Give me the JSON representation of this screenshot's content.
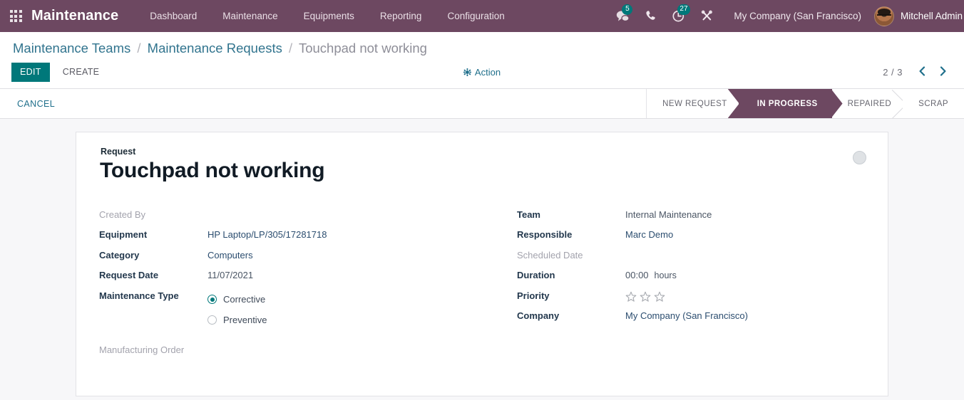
{
  "navbar": {
    "apps_icon": "apps-grid-icon",
    "brand": "Maintenance",
    "menu": [
      {
        "label": "Dashboard"
      },
      {
        "label": "Maintenance"
      },
      {
        "label": "Equipments"
      },
      {
        "label": "Reporting"
      },
      {
        "label": "Configuration"
      }
    ],
    "messaging": {
      "icon": "chat-bubble-icon",
      "badge": "5"
    },
    "voip": {
      "icon": "phone-icon"
    },
    "activities": {
      "icon": "clock-activity-icon",
      "badge": "27"
    },
    "debug": {
      "icon": "tools-wrench-icon"
    },
    "company": "My Company (San Francisco)",
    "user": "Mitchell Admin",
    "avatar_icon": "user-avatar",
    "bg_color": "#6d4861"
  },
  "breadcrumb": {
    "items": [
      {
        "label": "Maintenance Teams",
        "current": false
      },
      {
        "label": "Maintenance Requests",
        "current": false
      },
      {
        "label": "Touchpad not working",
        "current": true
      }
    ],
    "separator": "/"
  },
  "control_panel": {
    "edit_label": "EDIT",
    "create_label": "CREATE",
    "action_label": "Action",
    "action_icon": "gear-icon",
    "pager": {
      "counter": "2 / 3",
      "prev_icon": "chevron-left-icon",
      "next_icon": "chevron-right-icon"
    },
    "edit_color": "#00787a",
    "link_color": "#1f6f8b"
  },
  "statusbar": {
    "buttons": [
      {
        "label": "CANCEL"
      }
    ],
    "stages": [
      {
        "label": "NEW REQUEST",
        "active": false
      },
      {
        "label": "IN PROGRESS",
        "active": true
      },
      {
        "label": "REPAIRED",
        "active": false
      },
      {
        "label": "SCRAP",
        "active": false
      }
    ],
    "active_color": "#6d4861"
  },
  "form": {
    "title_label": "Request",
    "title_value": "Touchpad not working",
    "kanban_state_icon": "kanban-state-circle",
    "left_fields": [
      {
        "label": "Created By",
        "value": "",
        "type": "empty"
      },
      {
        "label": "Equipment",
        "value": "HP Laptop/LP/305/17281718",
        "type": "link"
      },
      {
        "label": "Category",
        "value": "Computers",
        "type": "link"
      },
      {
        "label": "Request Date",
        "value": "11/07/2021",
        "type": "text"
      }
    ],
    "maintenance_type": {
      "label": "Maintenance Type",
      "options": [
        {
          "label": "Corrective",
          "selected": true
        },
        {
          "label": "Preventive",
          "selected": false
        }
      ]
    },
    "manufacturing_order": {
      "label": "Manufacturing Order",
      "value": ""
    },
    "right_fields": [
      {
        "label": "Team",
        "value": "Internal Maintenance",
        "type": "text"
      },
      {
        "label": "Responsible",
        "value": "Marc Demo",
        "type": "link"
      },
      {
        "label": "Scheduled Date",
        "value": "",
        "type": "empty"
      }
    ],
    "duration": {
      "label": "Duration",
      "value": "00:00",
      "unit": "hours"
    },
    "priority": {
      "label": "Priority",
      "stars_total": 3,
      "stars_filled": 0,
      "star_icon": "star-outline-icon"
    },
    "company": {
      "label": "Company",
      "value": "My Company (San Francisco)",
      "type": "link"
    }
  }
}
